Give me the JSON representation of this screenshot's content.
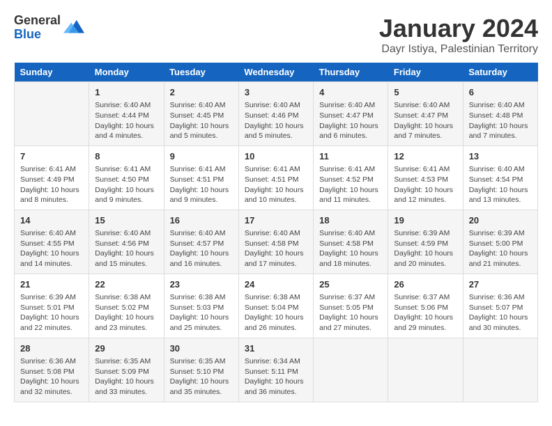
{
  "logo": {
    "general": "General",
    "blue": "Blue"
  },
  "title": "January 2024",
  "subtitle": "Dayr Istiya, Palestinian Territory",
  "headers": [
    "Sunday",
    "Monday",
    "Tuesday",
    "Wednesday",
    "Thursday",
    "Friday",
    "Saturday"
  ],
  "rows": [
    [
      {
        "num": "",
        "info": ""
      },
      {
        "num": "1",
        "info": "Sunrise: 6:40 AM\nSunset: 4:44 PM\nDaylight: 10 hours\nand 4 minutes."
      },
      {
        "num": "2",
        "info": "Sunrise: 6:40 AM\nSunset: 4:45 PM\nDaylight: 10 hours\nand 5 minutes."
      },
      {
        "num": "3",
        "info": "Sunrise: 6:40 AM\nSunset: 4:46 PM\nDaylight: 10 hours\nand 5 minutes."
      },
      {
        "num": "4",
        "info": "Sunrise: 6:40 AM\nSunset: 4:47 PM\nDaylight: 10 hours\nand 6 minutes."
      },
      {
        "num": "5",
        "info": "Sunrise: 6:40 AM\nSunset: 4:47 PM\nDaylight: 10 hours\nand 7 minutes."
      },
      {
        "num": "6",
        "info": "Sunrise: 6:40 AM\nSunset: 4:48 PM\nDaylight: 10 hours\nand 7 minutes."
      }
    ],
    [
      {
        "num": "7",
        "info": "Sunrise: 6:41 AM\nSunset: 4:49 PM\nDaylight: 10 hours\nand 8 minutes."
      },
      {
        "num": "8",
        "info": "Sunrise: 6:41 AM\nSunset: 4:50 PM\nDaylight: 10 hours\nand 9 minutes."
      },
      {
        "num": "9",
        "info": "Sunrise: 6:41 AM\nSunset: 4:51 PM\nDaylight: 10 hours\nand 9 minutes."
      },
      {
        "num": "10",
        "info": "Sunrise: 6:41 AM\nSunset: 4:51 PM\nDaylight: 10 hours\nand 10 minutes."
      },
      {
        "num": "11",
        "info": "Sunrise: 6:41 AM\nSunset: 4:52 PM\nDaylight: 10 hours\nand 11 minutes."
      },
      {
        "num": "12",
        "info": "Sunrise: 6:41 AM\nSunset: 4:53 PM\nDaylight: 10 hours\nand 12 minutes."
      },
      {
        "num": "13",
        "info": "Sunrise: 6:40 AM\nSunset: 4:54 PM\nDaylight: 10 hours\nand 13 minutes."
      }
    ],
    [
      {
        "num": "14",
        "info": "Sunrise: 6:40 AM\nSunset: 4:55 PM\nDaylight: 10 hours\nand 14 minutes."
      },
      {
        "num": "15",
        "info": "Sunrise: 6:40 AM\nSunset: 4:56 PM\nDaylight: 10 hours\nand 15 minutes."
      },
      {
        "num": "16",
        "info": "Sunrise: 6:40 AM\nSunset: 4:57 PM\nDaylight: 10 hours\nand 16 minutes."
      },
      {
        "num": "17",
        "info": "Sunrise: 6:40 AM\nSunset: 4:58 PM\nDaylight: 10 hours\nand 17 minutes."
      },
      {
        "num": "18",
        "info": "Sunrise: 6:40 AM\nSunset: 4:58 PM\nDaylight: 10 hours\nand 18 minutes."
      },
      {
        "num": "19",
        "info": "Sunrise: 6:39 AM\nSunset: 4:59 PM\nDaylight: 10 hours\nand 20 minutes."
      },
      {
        "num": "20",
        "info": "Sunrise: 6:39 AM\nSunset: 5:00 PM\nDaylight: 10 hours\nand 21 minutes."
      }
    ],
    [
      {
        "num": "21",
        "info": "Sunrise: 6:39 AM\nSunset: 5:01 PM\nDaylight: 10 hours\nand 22 minutes."
      },
      {
        "num": "22",
        "info": "Sunrise: 6:38 AM\nSunset: 5:02 PM\nDaylight: 10 hours\nand 23 minutes."
      },
      {
        "num": "23",
        "info": "Sunrise: 6:38 AM\nSunset: 5:03 PM\nDaylight: 10 hours\nand 25 minutes."
      },
      {
        "num": "24",
        "info": "Sunrise: 6:38 AM\nSunset: 5:04 PM\nDaylight: 10 hours\nand 26 minutes."
      },
      {
        "num": "25",
        "info": "Sunrise: 6:37 AM\nSunset: 5:05 PM\nDaylight: 10 hours\nand 27 minutes."
      },
      {
        "num": "26",
        "info": "Sunrise: 6:37 AM\nSunset: 5:06 PM\nDaylight: 10 hours\nand 29 minutes."
      },
      {
        "num": "27",
        "info": "Sunrise: 6:36 AM\nSunset: 5:07 PM\nDaylight: 10 hours\nand 30 minutes."
      }
    ],
    [
      {
        "num": "28",
        "info": "Sunrise: 6:36 AM\nSunset: 5:08 PM\nDaylight: 10 hours\nand 32 minutes."
      },
      {
        "num": "29",
        "info": "Sunrise: 6:35 AM\nSunset: 5:09 PM\nDaylight: 10 hours\nand 33 minutes."
      },
      {
        "num": "30",
        "info": "Sunrise: 6:35 AM\nSunset: 5:10 PM\nDaylight: 10 hours\nand 35 minutes."
      },
      {
        "num": "31",
        "info": "Sunrise: 6:34 AM\nSunset: 5:11 PM\nDaylight: 10 hours\nand 36 minutes."
      },
      {
        "num": "",
        "info": ""
      },
      {
        "num": "",
        "info": ""
      },
      {
        "num": "",
        "info": ""
      }
    ]
  ]
}
